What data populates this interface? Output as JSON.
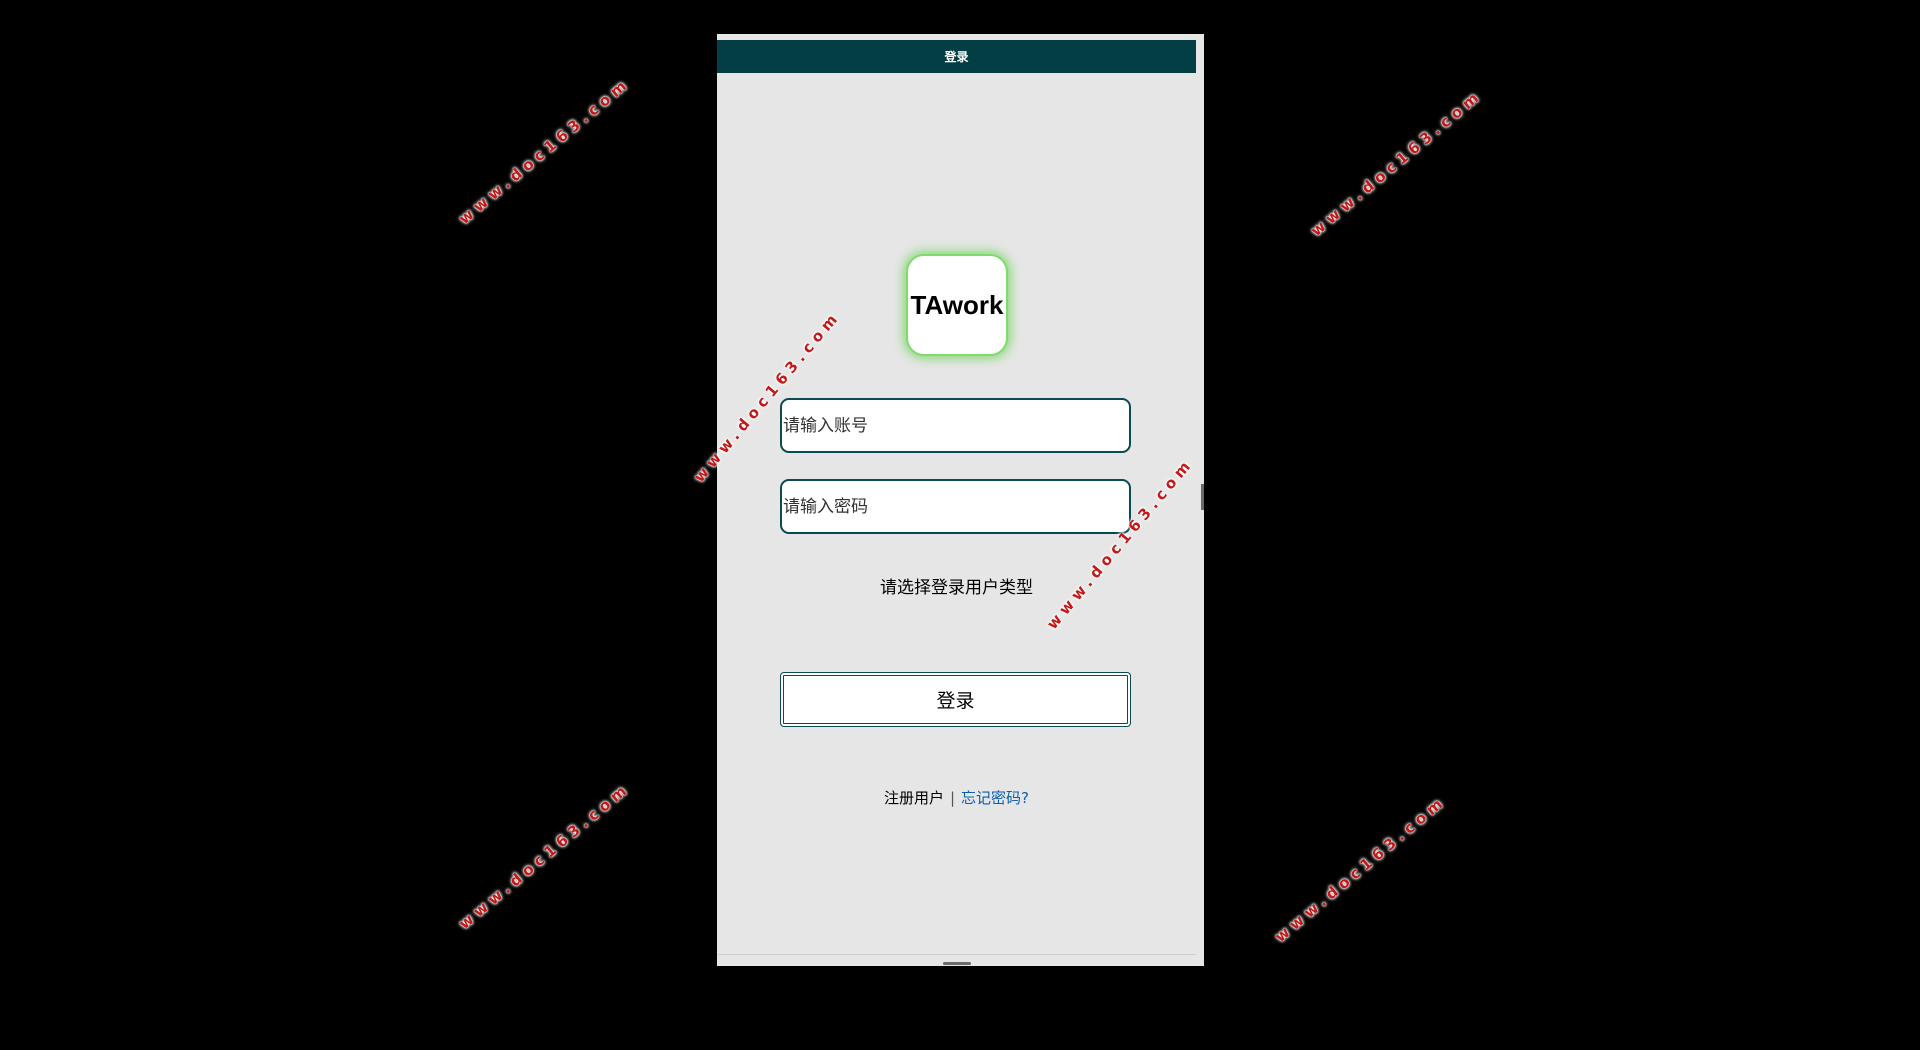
{
  "header": {
    "title": "登录"
  },
  "logo": {
    "text": "TAwork",
    "glow_color": "#7fdb6c"
  },
  "form": {
    "account_placeholder": "请输入账号",
    "password_placeholder": "请输入密码",
    "user_type_label": "请选择登录用户类型",
    "login_label": "登录"
  },
  "links": {
    "register": "注册用户",
    "separator": "|",
    "forgot": "忘记密码?"
  },
  "watermark": {
    "text": "www.doc163.com"
  },
  "colors": {
    "header_bg": "#033e45",
    "screen_bg": "#e6e6e6",
    "field_border": "#0b4a50",
    "link_blue": "#0a5fb0",
    "watermark": "#c21a1a"
  }
}
